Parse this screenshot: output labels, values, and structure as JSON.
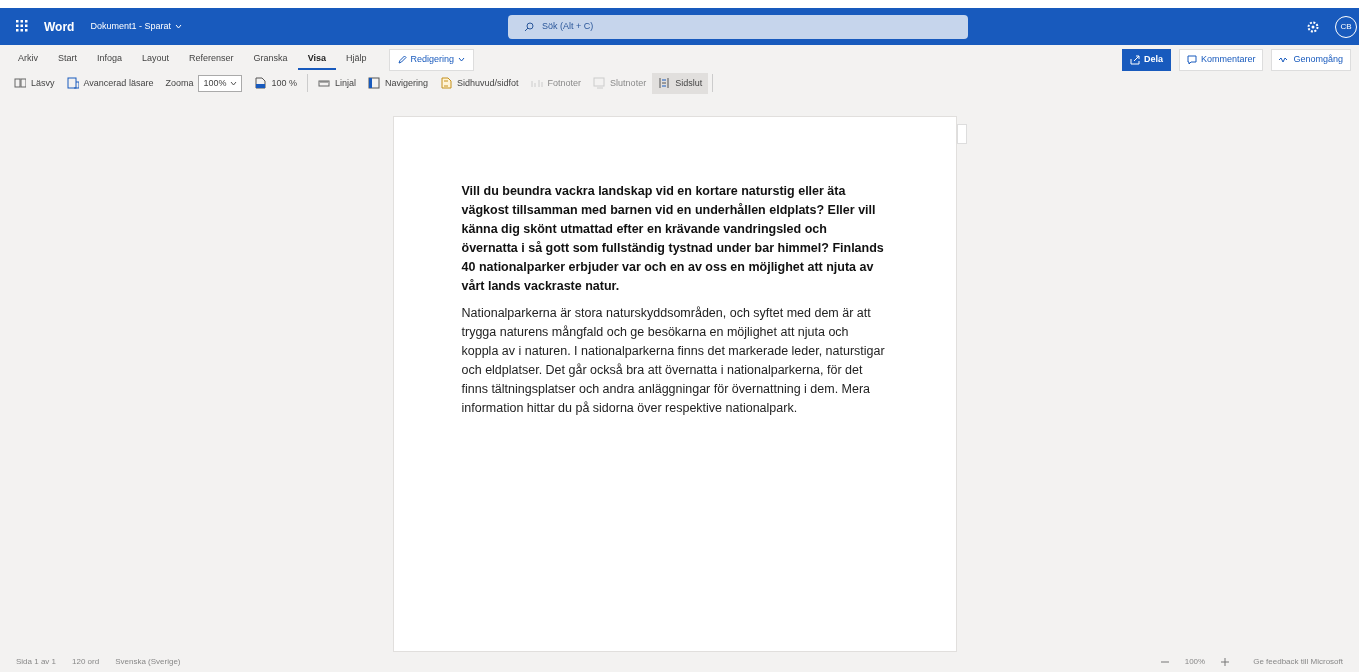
{
  "app": {
    "name": "Word",
    "document_title": "Dokument1 - Sparat",
    "search_placeholder": "Sök (Alt + C)",
    "avatar": "CB"
  },
  "menu_tabs": [
    {
      "label": "Arkiv",
      "selected": false
    },
    {
      "label": "Start",
      "selected": false
    },
    {
      "label": "Infoga",
      "selected": false
    },
    {
      "label": "Layout",
      "selected": false
    },
    {
      "label": "Referenser",
      "selected": false
    },
    {
      "label": "Granska",
      "selected": false
    },
    {
      "label": "Visa",
      "selected": true
    },
    {
      "label": "Hjälp",
      "selected": false
    }
  ],
  "mode_button": "Redigering",
  "actions": [
    {
      "label": "Dela",
      "kind": "primary"
    },
    {
      "label": "Kommentarer",
      "kind": "comment"
    },
    {
      "label": "Genomgång",
      "kind": "review"
    }
  ],
  "toolbar": [
    {
      "kind": "read",
      "label": "Läsvy",
      "disabled": false,
      "selected": false
    },
    {
      "kind": "reader",
      "label": "Avancerad läsare",
      "disabled": false,
      "selected": false
    },
    {
      "kind": "zoom",
      "label": "Zooma",
      "value": "100%"
    },
    {
      "kind": "page",
      "label": "100 %",
      "disabled": false,
      "selected": false
    },
    {
      "kind": "ruler",
      "label": "Linjal",
      "disabled": false,
      "selected": false
    },
    {
      "kind": "nav",
      "label": "Navigering",
      "disabled": false,
      "selected": false
    },
    {
      "kind": "header",
      "label": "Sidhuvud/sidfot",
      "disabled": false,
      "selected": false
    },
    {
      "kind": "foot",
      "label": "Fotnoter",
      "disabled": true,
      "selected": false
    },
    {
      "kind": "end",
      "label": "Slutnoter",
      "disabled": true,
      "selected": false
    },
    {
      "kind": "break",
      "label": "Sidslut",
      "disabled": false,
      "selected": true
    }
  ],
  "document": {
    "paragraphs": [
      {
        "kind": "bold",
        "text": "Vill du beundra vackra landskap vid en kortare naturstig eller äta vägkost tillsamman med barnen vid en underhållen eldplats? Eller vill känna dig skönt utmattad efter en krävande vandringsled och övernatta i så gott som fullständig tystnad under bar himmel? Finlands 40 nationalparker erbjuder var och en av oss en möjlighet att njuta av vårt lands vackraste natur."
      },
      {
        "kind": "normal",
        "text": "Nationalparkerna är stora naturskyddsområden, och syftet med dem är att trygga naturens mångfald och ge besökarna en möjlighet att njuta och koppla av i naturen. I nationalparkerna finns det markerade leder, naturstigar och eldplatser. Det går också bra att övernatta i nationalparkerna, för det finns tältningsplatser och andra anläggningar för övernattning i dem. Mera information hittar du på sidorna över respektive nationalpark."
      }
    ]
  },
  "status_bar": {
    "left": [
      "Sida 1 av 1",
      "120 ord",
      "Svenska (Sverige)"
    ],
    "zoom": "100%",
    "feedback": "Ge feedback till Microsoft"
  }
}
